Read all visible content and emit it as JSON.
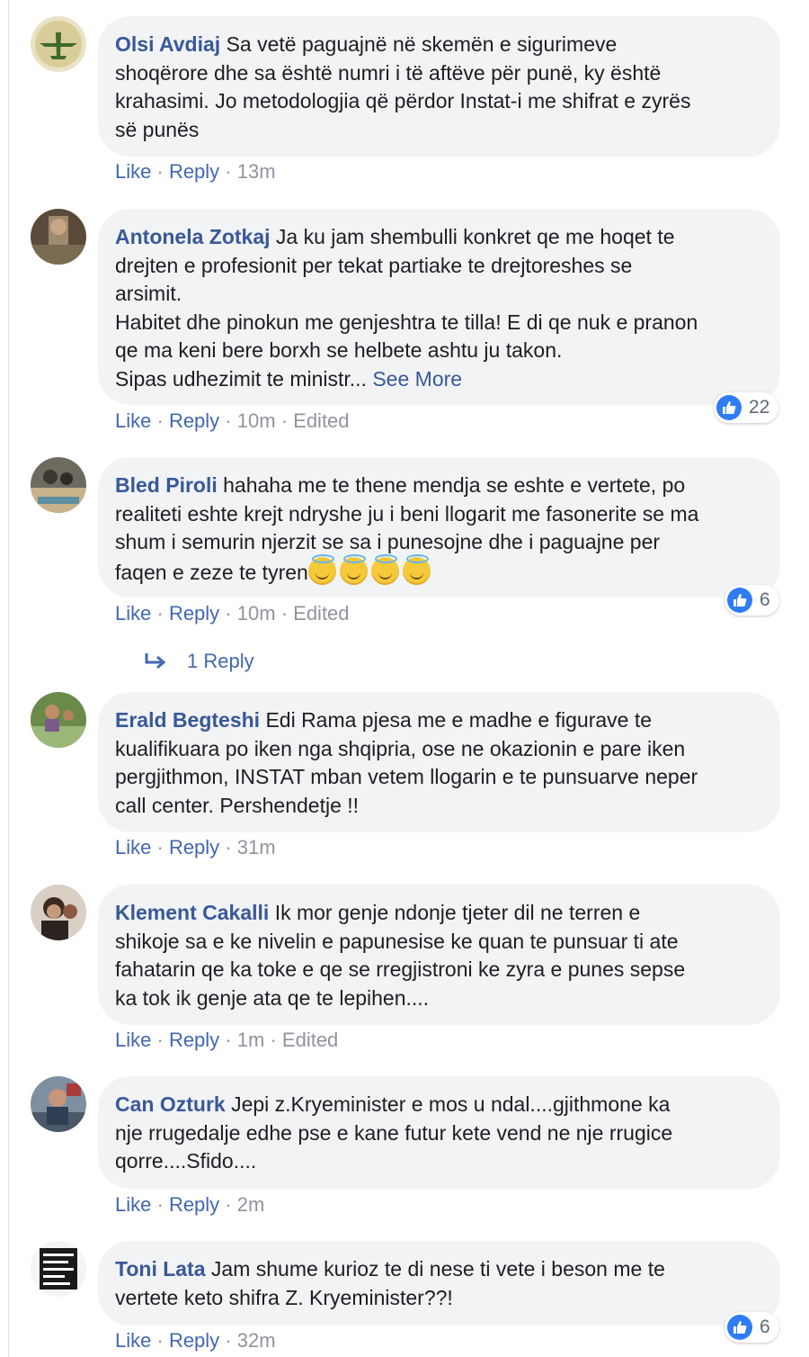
{
  "actions": {
    "like": "Like",
    "reply": "Reply",
    "edited": "Edited",
    "dot": "·"
  },
  "colors": {
    "author": "#385898",
    "link": "#4267b2",
    "bubble": "#f2f3f5",
    "like_badge": "#2e7cf6"
  },
  "icons": {
    "reaction": "like-icon",
    "reply_arrow": "reply-arrow-icon",
    "emoji": "smiling-face-with-halo-emoji"
  },
  "comments": [
    {
      "author": "Olsi Avdiaj",
      "lines": [
        "Sa vetë paguajnë në skemën e sigurimeve",
        "shoqërore dhe sa është numri i të aftëve për punë, ky është",
        "krahasimi. Jo metodologjia që përdor Instat-i me shifrat e zyrës",
        "së punës"
      ],
      "time": "13m"
    },
    {
      "author": "Antonela Zotkaj",
      "lines": [
        "Ja ku jam shembulli konkret qe me hoqet te",
        "drejten e profesionit per tekat partiake te drejtoreshes se",
        "arsimit.",
        "Habitet dhe pinokun me genjeshtra te tilla! E di qe nuk e pranon",
        "qe ma keni bere borxh se helbete ashtu ju takon.",
        "Sipas udhezimit te ministr..."
      ],
      "see_more": "See More",
      "time": "10m",
      "edited": true,
      "reactions": "22"
    },
    {
      "author": "Bled Piroli",
      "lines": [
        "hahaha me te thene mendja se eshte e vertete, po",
        "realiteti eshte krejt ndryshe ju i beni llogarit me fasonerite se ma",
        "shum i semurin njerzit se sa i punesojne dhe i paguajne per",
        "faqen e zeze te tyren"
      ],
      "emoji_count": 4,
      "time": "10m",
      "edited": true,
      "reactions": "6",
      "replies_label": "1 Reply"
    },
    {
      "author": "Erald Begteshi",
      "lines": [
        "Edi Rama pjesa me e madhe e figurave te",
        "kualifikuara po iken nga shqipria, ose ne okazionin e pare iken",
        "pergjithmon, INSTAT mban vetem llogarin e te punsuarve neper",
        "call center. Pershendetje !!"
      ],
      "time": "31m"
    },
    {
      "author": "Klement Cakalli",
      "lines": [
        "Ik mor genje ndonje tjeter dil ne terren e",
        "shikoje sa e ke nivelin e papunesise ke quan te punsuar ti ate",
        "fahatarin qe ka toke e qe se rregjistroni ke zyra e punes sepse",
        "ka tok ik genje ata qe te lepihen...."
      ],
      "time": "1m",
      "edited": true
    },
    {
      "author": "Can Ozturk",
      "lines": [
        "Jepi z.Kryeminister e mos u ndal....gjithmone ka",
        "nje rrugedalje edhe pse e kane futur kete vend ne nje rrugice",
        "qorre....Sfido...."
      ],
      "time": "2m"
    },
    {
      "author": "Toni Lata",
      "lines": [
        "Jam shume kurioz te di nese ti vete i beson me te",
        "vertete keto shifra Z. Kryeminister??!"
      ],
      "time": "32m",
      "reactions": "6"
    }
  ]
}
